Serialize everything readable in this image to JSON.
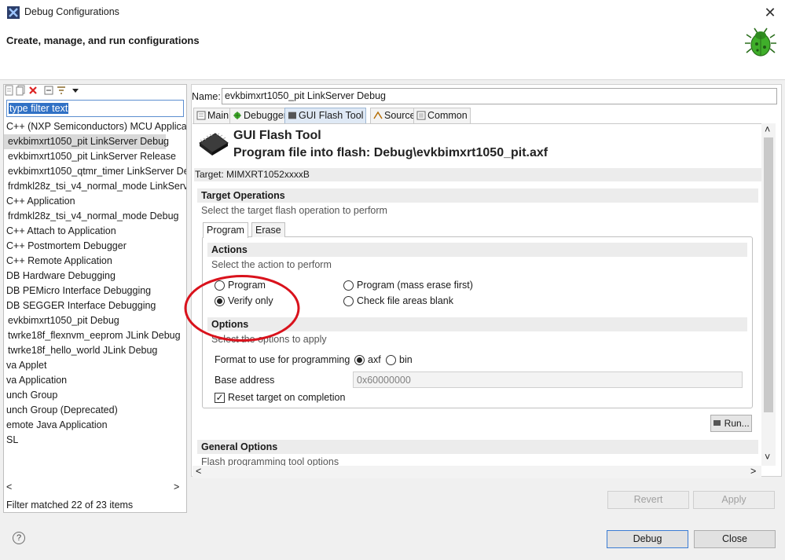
{
  "window": {
    "title": "Debug Configurations",
    "close_glyph": "✕"
  },
  "header": {
    "title": "Create, manage, and run configurations"
  },
  "left": {
    "filter_text": "type filter text",
    "items": [
      "C++ (NXP Semiconductors) MCU Applicat",
      "evkbimxrt1050_pit LinkServer Debug",
      "evkbimxrt1050_pit LinkServer Release",
      "evkbimxrt1050_qtmr_timer LinkServer Del",
      "frdmkl28z_tsi_v4_normal_mode LinkServe",
      "C++ Application",
      "frdmkl28z_tsi_v4_normal_mode Debug",
      "C++ Attach to Application",
      "C++ Postmortem Debugger",
      "C++ Remote Application",
      "DB Hardware Debugging",
      "DB PEMicro Interface Debugging",
      "DB SEGGER Interface Debugging",
      "evkbimxrt1050_pit Debug",
      "twrke18f_flexnvm_eeprom JLink Debug",
      "twrke18f_hello_world JLink Debug",
      "va Applet",
      "va Application",
      "unch Group",
      "unch Group (Deprecated)",
      "emote Java Application",
      "SL"
    ],
    "status": "Filter matched 22 of 23 items"
  },
  "right": {
    "name_label": "Name:",
    "name_value": "evkbimxrt1050_pit LinkServer Debug",
    "tabs": [
      "Main",
      "Debugger",
      "GUI Flash Tool",
      "Source",
      "Common"
    ],
    "gft_title": "GUI Flash Tool",
    "gft_subtitle": "Program file into flash: Debug\\evkbimxrt1050_pit.axf",
    "target": "Target: MIMXRT1052xxxxB",
    "target_ops": {
      "title": "Target Operations",
      "desc": "Select the target flash operation to perform"
    },
    "inner_tabs": [
      "Program",
      "Erase"
    ],
    "actions": {
      "title": "Actions",
      "desc": "Select the action to perform",
      "program": "Program",
      "program_mass": "Program (mass erase first)",
      "verify": "Verify only",
      "check_blank": "Check file areas blank"
    },
    "options": {
      "title": "Options",
      "desc": "Select the options to apply",
      "format_label": "Format to use for programming",
      "axf": "axf",
      "bin": "bin",
      "base_label": "Base address",
      "base_value": "0x60000000",
      "reset_label": "Reset target on completion",
      "reset_glyph": "✓"
    },
    "run_label": "Run...",
    "general": {
      "title": "General Options",
      "desc": "Flash programming tool options"
    }
  },
  "buttons": {
    "revert": "Revert",
    "apply": "Apply",
    "debug": "Debug",
    "close": "Close",
    "help": "?"
  },
  "glyphs": {
    "left": "<",
    "right": ">",
    "up": "˄",
    "down": "˅"
  },
  "colors": {
    "selection": "#3071c5",
    "annotation_red": "#d9121c",
    "bug_green": "#3fae2a"
  }
}
